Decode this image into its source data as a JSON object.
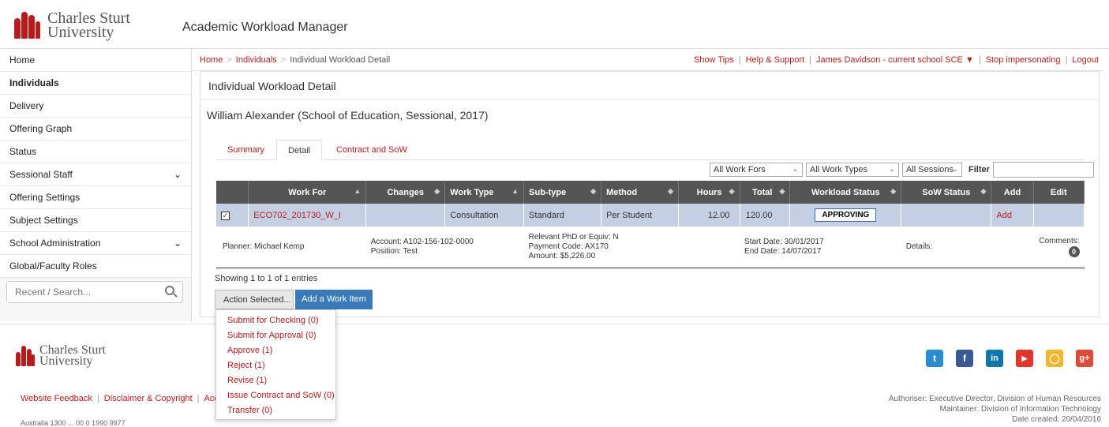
{
  "header": {
    "logo_line1": "Charles Sturt",
    "logo_line2": "University",
    "app_title": "Academic Workload Manager"
  },
  "sidebar": {
    "items": [
      {
        "label": "Home"
      },
      {
        "label": "Individuals"
      },
      {
        "label": "Delivery"
      },
      {
        "label": "Offering Graph"
      },
      {
        "label": "Status"
      },
      {
        "label": "Sessional Staff"
      },
      {
        "label": "Offering Settings"
      },
      {
        "label": "Subject Settings"
      },
      {
        "label": "School Administration"
      },
      {
        "label": "Global/Faculty Roles"
      }
    ],
    "search_placeholder": "Recent / Search..."
  },
  "breadcrumb": {
    "home": "Home",
    "individuals": "Individuals",
    "current": "Individual Workload Detail"
  },
  "toplinks": {
    "show_tips": "Show Tips",
    "help": "Help & Support",
    "user": "James Davidson - current school SCE",
    "stop": "Stop impersonating",
    "logout": "Logout"
  },
  "main": {
    "page_title": "Individual Workload Detail",
    "person": "William Alexander (School of Education, Sessional, 2017)",
    "tabs": [
      "Summary",
      "Detail",
      "Contract and SoW"
    ],
    "filters": {
      "work_fors": "All Work Fors",
      "work_types": "All Work Types",
      "sessions": "All Sessions",
      "filter_label": "Filter"
    },
    "columns": [
      "Work For",
      "Changes",
      "Work Type",
      "Sub-type",
      "Method",
      "Hours",
      "Total",
      "Workload Status",
      "SoW Status",
      "Add",
      "Edit"
    ],
    "row": {
      "work_for": "ECO702_201730_W_I",
      "changes": "",
      "work_type": "Consultation",
      "subtype": "Standard",
      "method": "Per Student",
      "hours": "12.00",
      "total": "120.00",
      "status": "APPROVING",
      "sow_status": "",
      "add": "Add"
    },
    "detail": {
      "planner": "Planner: Michael Kemp",
      "account": "Account: A102-156-102-0000",
      "position": "Position: Test",
      "phd": "Relevant PhD or Equiv: N",
      "payment_code": "Payment Code: AX170",
      "amount": "Amount: $5,226.00",
      "start": "Start Date: 30/01/2017",
      "end": "End Date: 14/07/2017",
      "details": "Details:",
      "comments_label": "Comments:",
      "comments_count": "0"
    },
    "showing": "Showing 1 to 1 of 1 entries",
    "action_btn": "Action Selected...",
    "add_btn": "Add a Work Item"
  },
  "menu": {
    "items": [
      "Submit for Checking (0)",
      "Submit for Approval (0)",
      "Approve (1)",
      "Reject (1)",
      "Revise (1)",
      "Issue Contract and SoW (0)",
      "Transfer (0)"
    ]
  },
  "footer": {
    "logo_line1": "Charles Sturt",
    "logo_line2": "University",
    "link1": "Website Feedback",
    "link2": "Disclaimer & Copyright",
    "link3": "Acces",
    "authoriser": "Authoriser: Executive Director, Division of Human Resources",
    "maintainer": "Maintainer: Division of Information Technology",
    "date_created": "Date created: 20/04/2016",
    "cut_text": "Australia 1300 ... 00 0 1990 9977"
  },
  "colors": {
    "brand": "#b71c1c",
    "header_dark": "#555555",
    "selected_row": "#c5cfe3",
    "button_blue": "#3a7ab8"
  }
}
